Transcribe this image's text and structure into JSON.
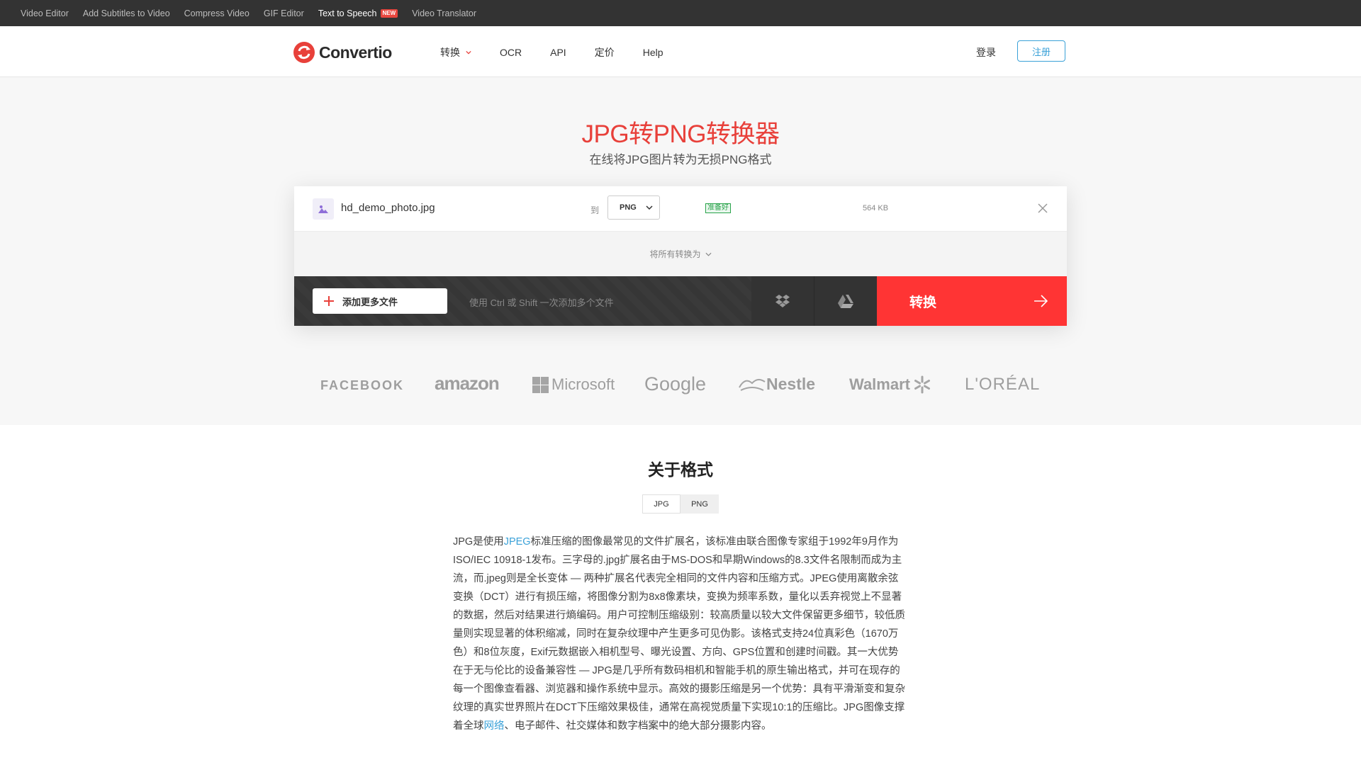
{
  "topbar": {
    "links": [
      "Video Editor",
      "Add Subtitles to Video",
      "Compress Video",
      "GIF Editor",
      "Text to Speech",
      "Video Translator"
    ],
    "new_badge": "NEW"
  },
  "header": {
    "logo_text": "Convertio",
    "nav": [
      "转换",
      "OCR",
      "API",
      "定价",
      "Help"
    ],
    "login": "登录",
    "signup": "注册"
  },
  "hero": {
    "title": "JPG转PNG转换器",
    "subtitle": "在线将JPG图片转为无损PNG格式"
  },
  "file": {
    "name": "hd_demo_photo.jpg",
    "to_label": "到",
    "format": "PNG",
    "status": "准备好",
    "size": "564 KB"
  },
  "convert_all": "将所有转换为",
  "actions": {
    "add_files": "添加更多文件",
    "hint": "使用 Ctrl 或 Shift 一次添加多个文件",
    "convert": "转换"
  },
  "brands": [
    "FACEBOOK",
    "amazon",
    "Microsoft",
    "Google",
    "Nestle",
    "Walmart",
    "L'ORÉAL"
  ],
  "about": {
    "title": "关于格式",
    "tabs": [
      "JPG",
      "PNG"
    ],
    "paragraph_start": "JPG是使用",
    "link1": "JPEG",
    "paragraph_mid": "标准压缩的图像最常见的文件扩展名，该标准由联合图像专家组于1992年9月作为ISO/IEC 10918-1发布。三字母的.jpg扩展名由于MS-DOS和早期Windows的8.3文件名限制而成为主流，而.jpeg则是全长变体 — 两种扩展名代表完全相同的文件内容和压缩方式。JPEG使用离散余弦变换（DCT）进行有损压缩，将图像分割为8x8像素块，变换为频率系数，量化以丢弃视觉上不显著的数据，然后对结果进行熵编码。用户可控制压缩级别：较高质量以较大文件保留更多细节，较低质量则实现显著的体积缩减，同时在复杂纹理中产生更多可见伪影。该格式支持24位真彩色（1670万色）和8位灰度，Exif元数据嵌入相机型号、曝光设置、方向、GPS位置和创建时间戳。其一大优势在于无与伦比的设备兼容性 — JPG是几乎所有数码相机和智能手机的原生输出格式，并可在现存的每一个图像查看器、浏览器和操作系统中显示。高效的摄影压缩是另一个优势：具有平滑渐变和复杂纹理的真实世界照片在DCT下压缩效果极佳，通常在高视觉质量下实现10:1的压缩比。JPG图像支撑着全球",
    "link2": "网络",
    "paragraph_end": "、电子邮件、社交媒体和数字档案中的绝大部分摄影内容。"
  },
  "colors": {
    "accent_red": "#ff3434",
    "title_red": "#e8403a",
    "link_blue": "#3aa1d8"
  }
}
